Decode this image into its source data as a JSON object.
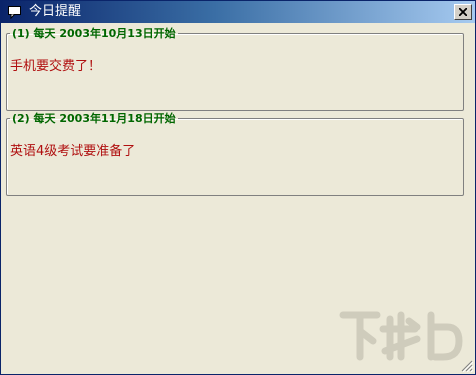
{
  "window": {
    "title": "今日提醒"
  },
  "reminders": [
    {
      "header": "(1) 每天 2003年10月13日开始",
      "message": "手机要交费了！"
    },
    {
      "header": "(2) 每天 2003年11月18日开始",
      "message": "英语4级考试要准备了"
    }
  ],
  "watermark": {
    "text": "下载吧"
  },
  "colors": {
    "title_bar": "#0a246a",
    "legend": "#006600",
    "message": "#b01010",
    "background": "#ece9d8"
  }
}
